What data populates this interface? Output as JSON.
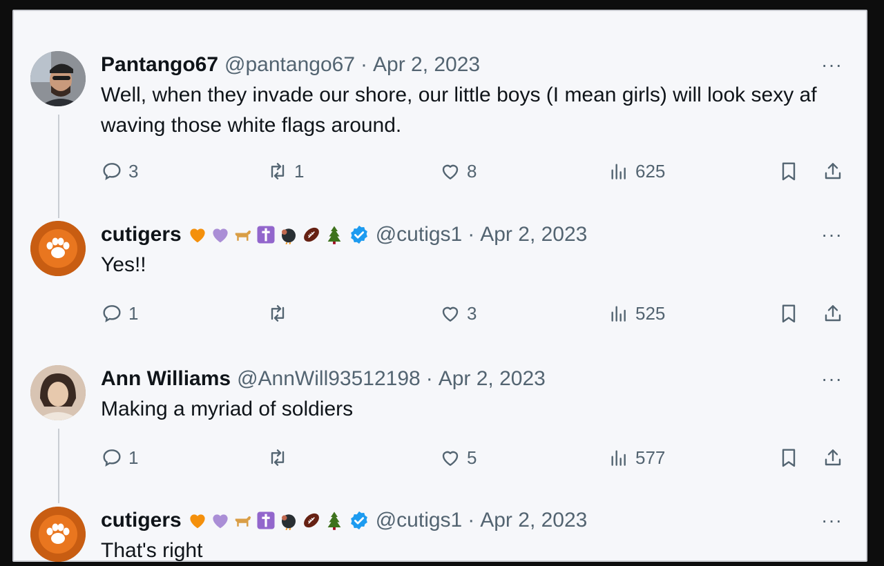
{
  "colors": {
    "text": "#0f1419",
    "muted": "#536471",
    "verified": "#1d9bf0",
    "background": "#f6f7fa"
  },
  "tweets": [
    {
      "name": "Pantango67",
      "handle": "@pantango67",
      "separator": "·",
      "date": "Apr 2, 2023",
      "more": "···",
      "text": "Well, when they invade our shore, our little boys (I mean girls) will look sexy af waving those white flags around.",
      "replies": "3",
      "retweets": "1",
      "likes": "8",
      "views": "625",
      "avatar": "man-in-cap-photo",
      "verified": false,
      "emojis": []
    },
    {
      "name": "cutigers",
      "handle": "@cutigs1",
      "separator": "·",
      "date": "Apr 2, 2023",
      "more": "···",
      "text": "Yes!!",
      "replies": "1",
      "retweets": "",
      "likes": "3",
      "views": "525",
      "avatar": "tiger-paw-logo",
      "verified": true,
      "emojis": [
        "orange-heart",
        "purple-heart",
        "dog",
        "cross",
        "turkey",
        "football",
        "tree"
      ]
    },
    {
      "name": "Ann Williams",
      "handle": "@AnnWill93512198",
      "separator": "·",
      "date": "Apr 2, 2023",
      "more": "···",
      "text": "Making a myriad of soldiers",
      "replies": "1",
      "retweets": "",
      "likes": "5",
      "views": "577",
      "avatar": "woman-photo",
      "verified": false,
      "emojis": []
    },
    {
      "name": "cutigers",
      "handle": "@cutigs1",
      "separator": "·",
      "date": "Apr 2, 2023",
      "more": "···",
      "text": "That's right",
      "avatar": "tiger-paw-logo",
      "verified": true,
      "emojis": [
        "orange-heart",
        "purple-heart",
        "dog",
        "cross",
        "turkey",
        "football",
        "tree"
      ]
    }
  ]
}
